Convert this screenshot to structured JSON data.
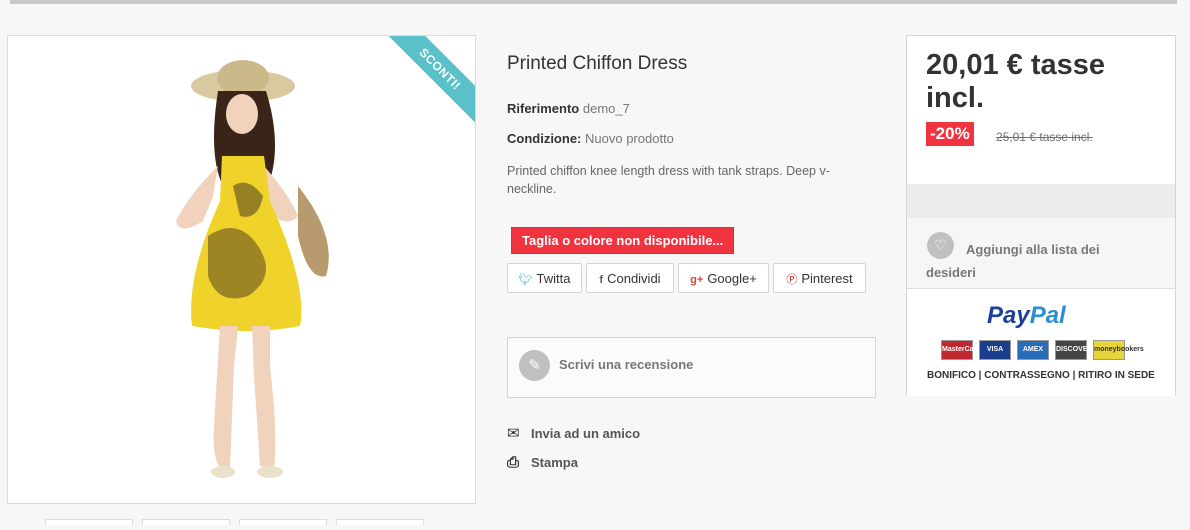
{
  "product": {
    "badge": "SCONTI!",
    "title": "Printed Chiffon Dress",
    "reference_label": "Riferimento",
    "reference_value": "demo_7",
    "condition_label": "Condizione:",
    "condition_value": "Nuovo prodotto",
    "description": "Printed chiffon knee length dress with tank straps. Deep v-neckline.",
    "availability": "Taglia o colore non disponibile..."
  },
  "share": [
    {
      "label": "Twitta",
      "icon": "twitter-icon",
      "color": "#2ca0d9"
    },
    {
      "label": "Condividi",
      "icon": "facebook-icon",
      "color": "#3b5998"
    },
    {
      "label": "Google+",
      "icon": "google-plus-icon",
      "color": "#d34836"
    },
    {
      "label": "Pinterest",
      "icon": "pinterest-icon",
      "color": "#cb2027"
    }
  ],
  "review": {
    "label": "Scrivi una recensione",
    "icon": "pencil-icon"
  },
  "actions": {
    "send_friend": "Invia ad un amico",
    "print": "Stampa"
  },
  "pricing": {
    "price": "20,01 € tasse incl.",
    "discount": "-20%",
    "old_price": "25,01 € tasse incl.",
    "accent_color": "#f13340"
  },
  "wishlist": {
    "label": "Aggiungi alla lista dei desideri",
    "icon": "heart-icon"
  },
  "payment": {
    "logo_pay": "Pay",
    "logo_pal": "Pal",
    "cards": [
      "MasterCard",
      "VISA",
      "AMEX",
      "DISCOVER",
      "moneybookers"
    ],
    "methods": "BONIFICO | CONTRASSEGNO | RITIRO IN SEDE"
  }
}
